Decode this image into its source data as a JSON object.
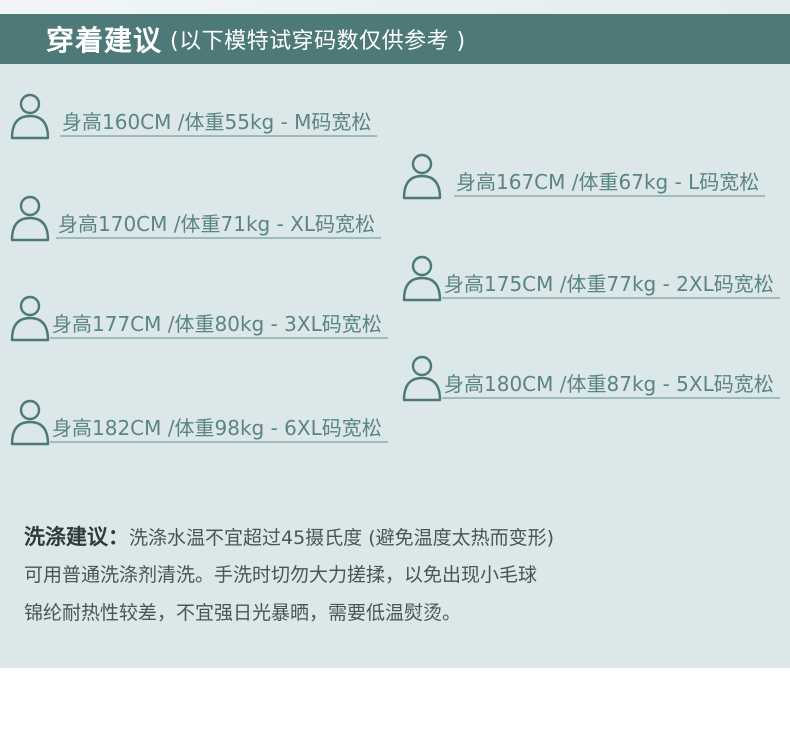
{
  "header": {
    "title": "穿着建议",
    "subtitle": "(以下模特试穿码数仅供参考 )"
  },
  "sizes": [
    {
      "text": "身高160CM /体重55kg - M码宽松"
    },
    {
      "text": "身高167CM /体重67kg - L码宽松"
    },
    {
      "text": "身高170CM /体重71kg - XL码宽松"
    },
    {
      "text": "身高175CM /体重77kg - 2XL码宽松"
    },
    {
      "text": "身高177CM /体重80kg - 3XL码宽松"
    },
    {
      "text": "身高180CM /体重87kg - 5XL码宽松"
    },
    {
      "text": "身高182CM /体重98kg - 6XL码宽松"
    }
  ],
  "care": {
    "title": "洗涤建议：",
    "line1": "洗涤水温不宜超过45摄氏度 (避免温度太热而变形)",
    "line2": "可用普通洗涤剂清洗。手洗时切勿大力搓揉，以免出现小毛球",
    "line3": "锦纶耐热性较差，不宜强日光暴晒，需要低温熨烫。"
  },
  "colors": {
    "header_bg": "#4d7a78",
    "panel_bg": "#dbe7e8",
    "text_teal": "#5b8583",
    "icon_stroke": "#4d7a78"
  },
  "icons": {
    "person": "person-outline-icon"
  }
}
